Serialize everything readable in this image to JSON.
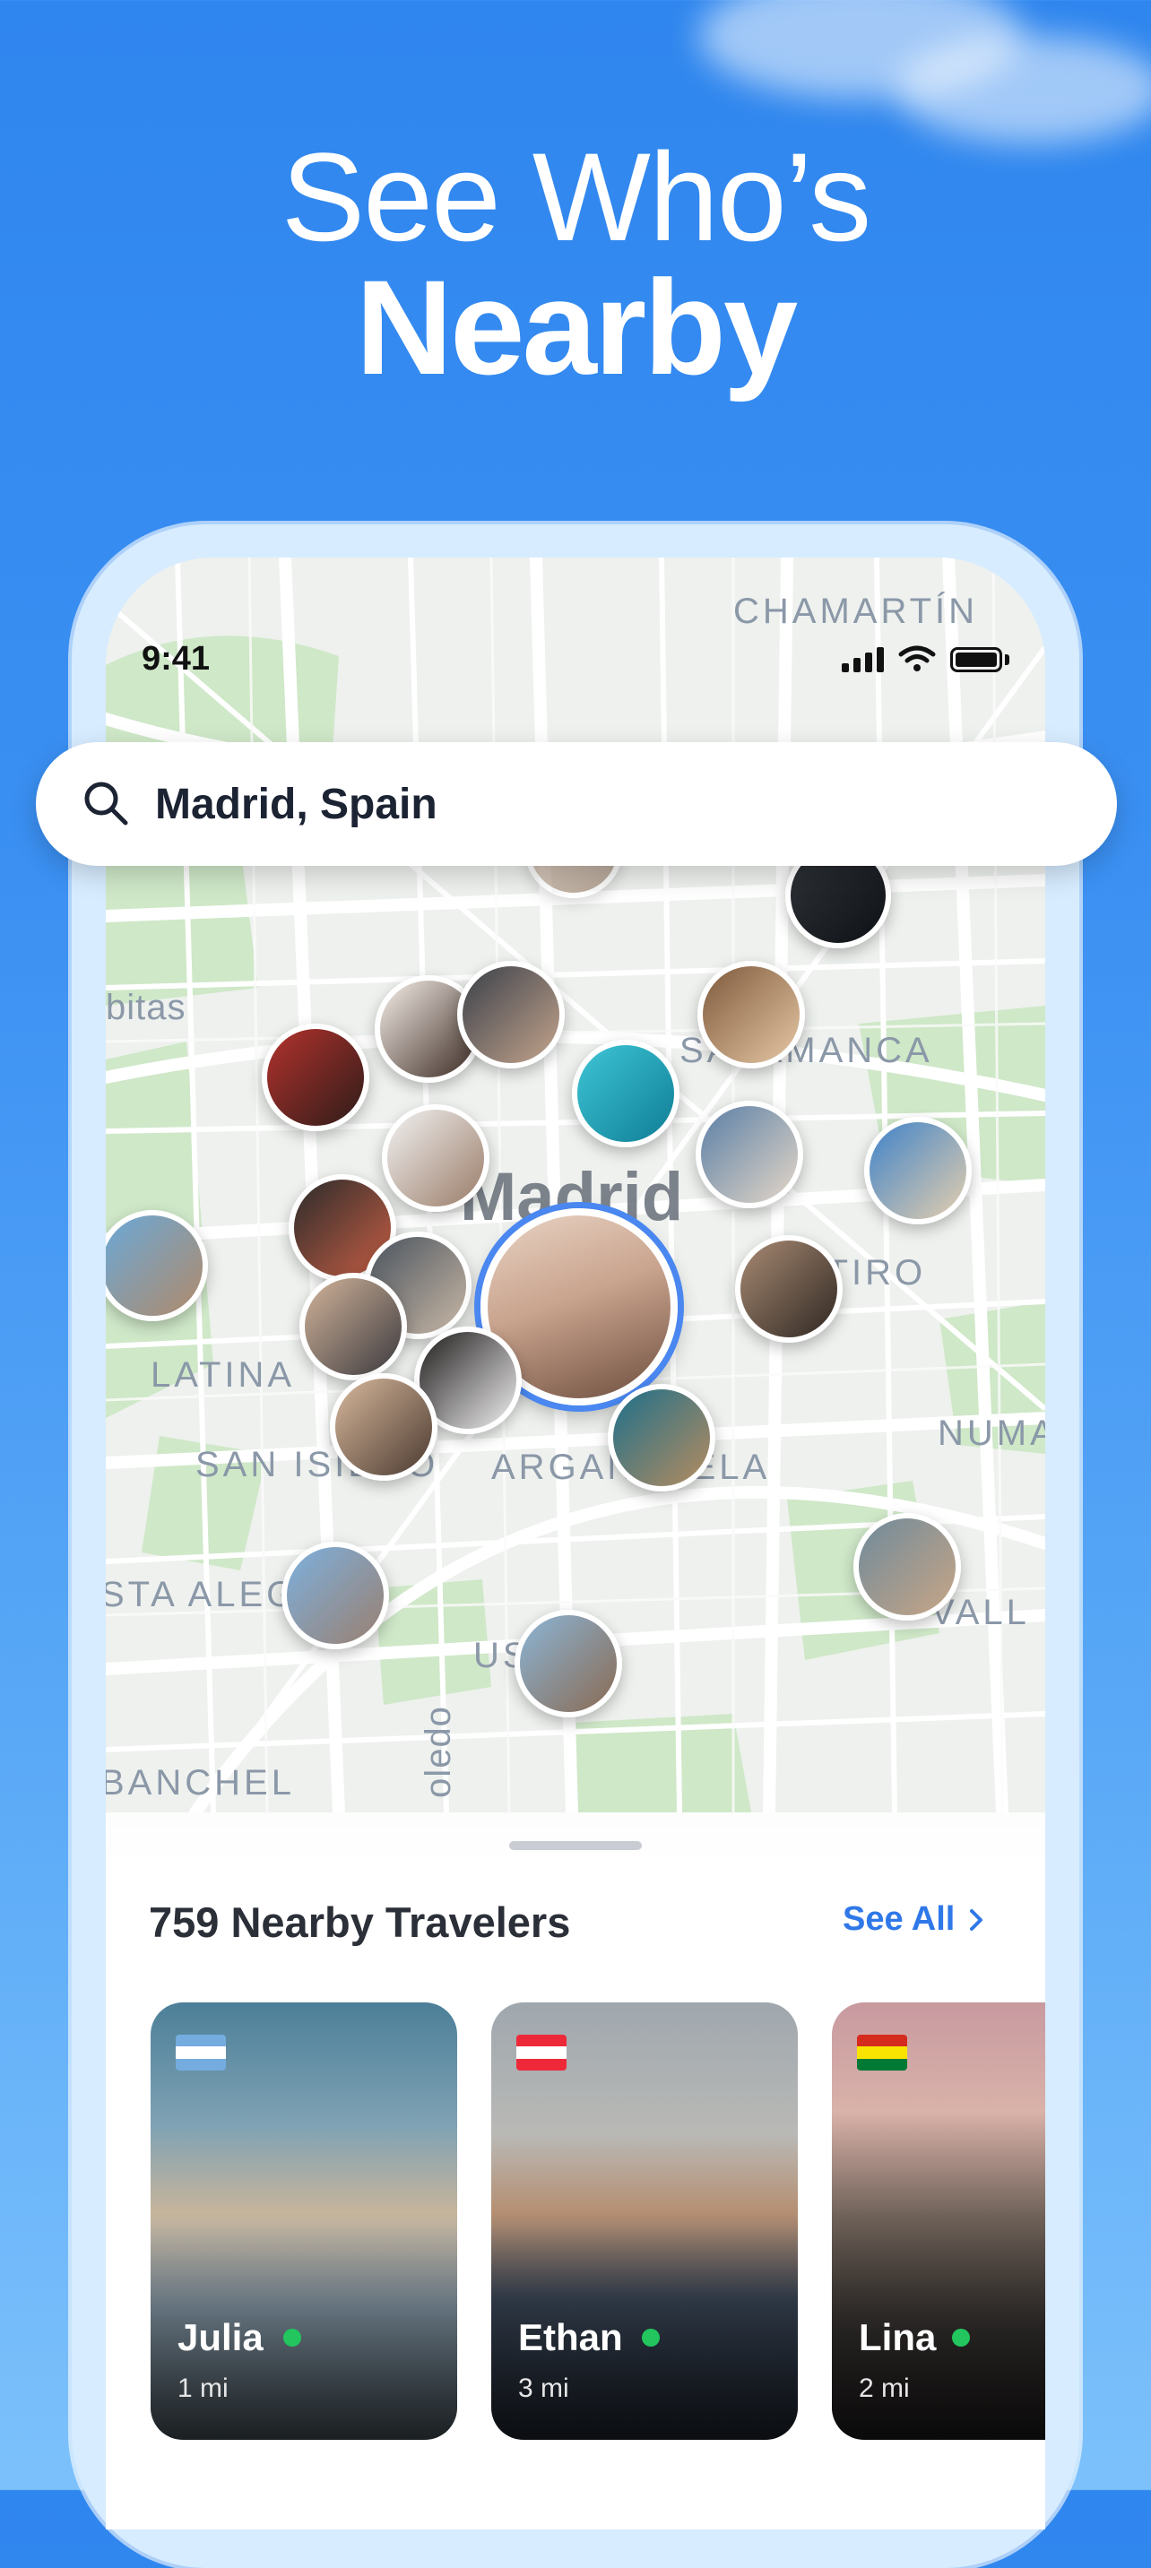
{
  "headline": {
    "line1": "See Who’s",
    "line2": "Nearby"
  },
  "status_bar": {
    "time": "9:41"
  },
  "map": {
    "city": "Madrid",
    "districts": [
      "CHAMARTÍN",
      "bitas",
      "SALAMANCA",
      "RETIRO",
      "LATINA",
      "SAN ISIDRO",
      "ARGANZUELA",
      "NUMA",
      "STA ALEGRE",
      "VALL",
      "US",
      "BANCHEL",
      "oledo"
    ]
  },
  "search": {
    "value": "Madrid, Spain"
  },
  "nearby": {
    "title": "759 Nearby Travelers",
    "see_all": "See All",
    "travelers": [
      {
        "name": "Julia",
        "distance": "1 mi",
        "flag": "argentina"
      },
      {
        "name": "Ethan",
        "distance": "3 mi",
        "flag": "austria"
      },
      {
        "name": "Lina",
        "distance": "2 mi",
        "flag": "bolivia"
      }
    ]
  },
  "colors": {
    "accent": "#2f78e8",
    "online": "#22c55e",
    "background": "#2f86ee"
  }
}
